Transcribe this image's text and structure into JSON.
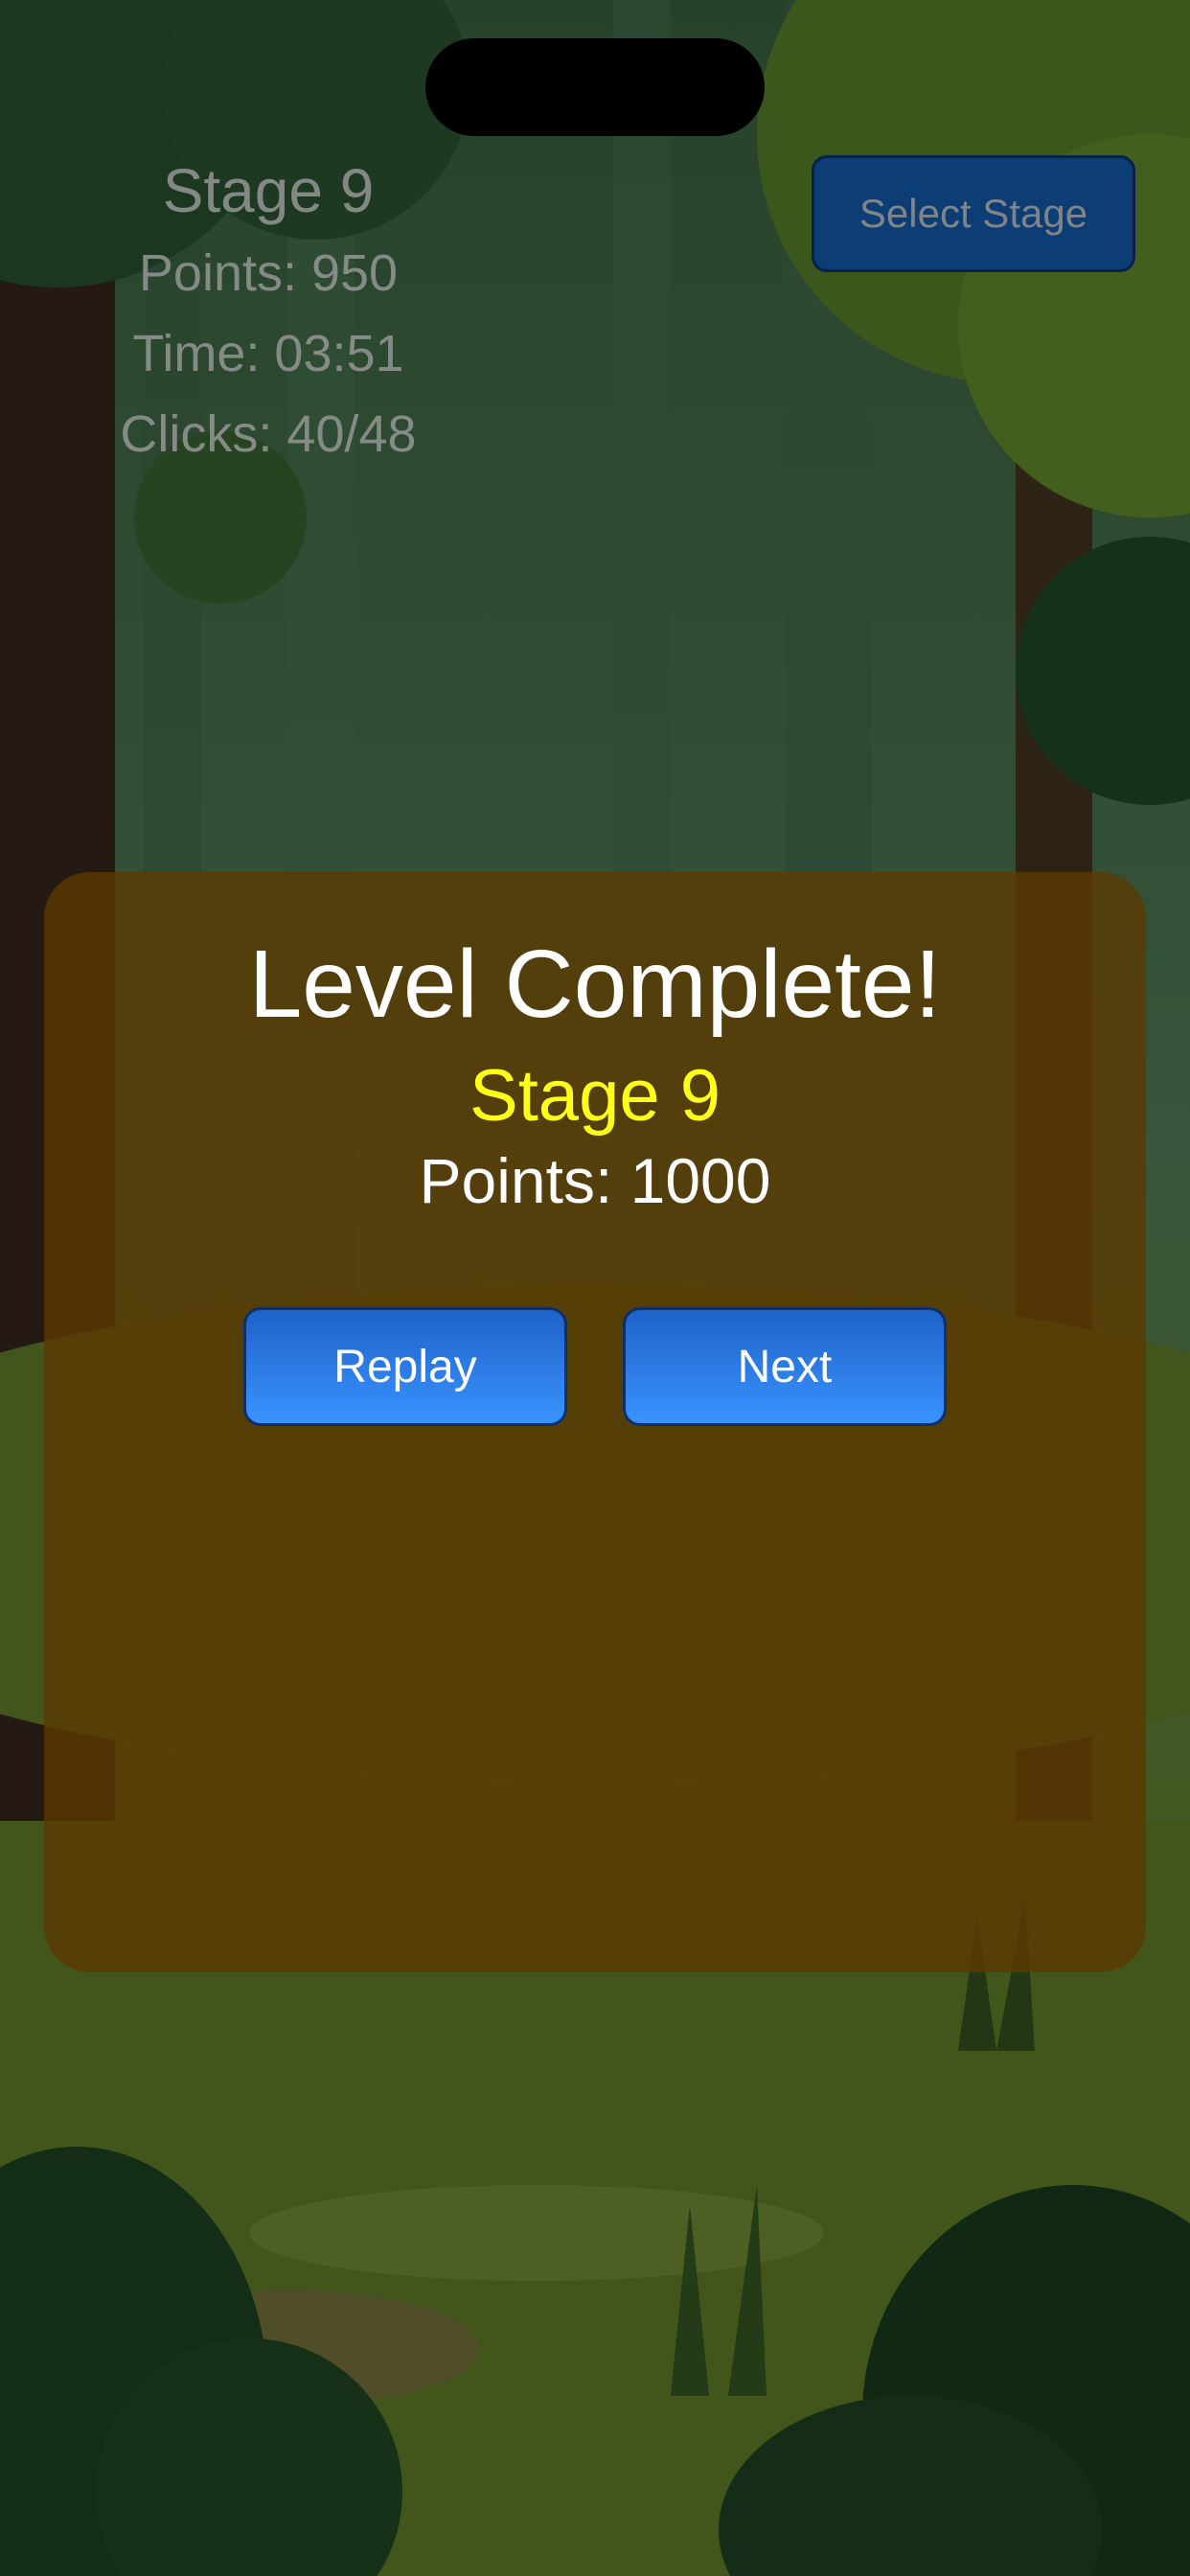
{
  "hud": {
    "stage": "Stage 9",
    "points": "Points: 950",
    "time": "Time: 03:51",
    "clicks": "Clicks: 40/48"
  },
  "header": {
    "select_stage_label": "Select Stage"
  },
  "dialog": {
    "title": "Level Complete!",
    "stage": "Stage 9",
    "points": "Points: 1000",
    "replay_label": "Replay",
    "next_label": "Next"
  },
  "colors": {
    "dialog_background": "#5c3a00",
    "stage_highlight": "#ffff1a",
    "button_blue": "#2f7fe8"
  }
}
